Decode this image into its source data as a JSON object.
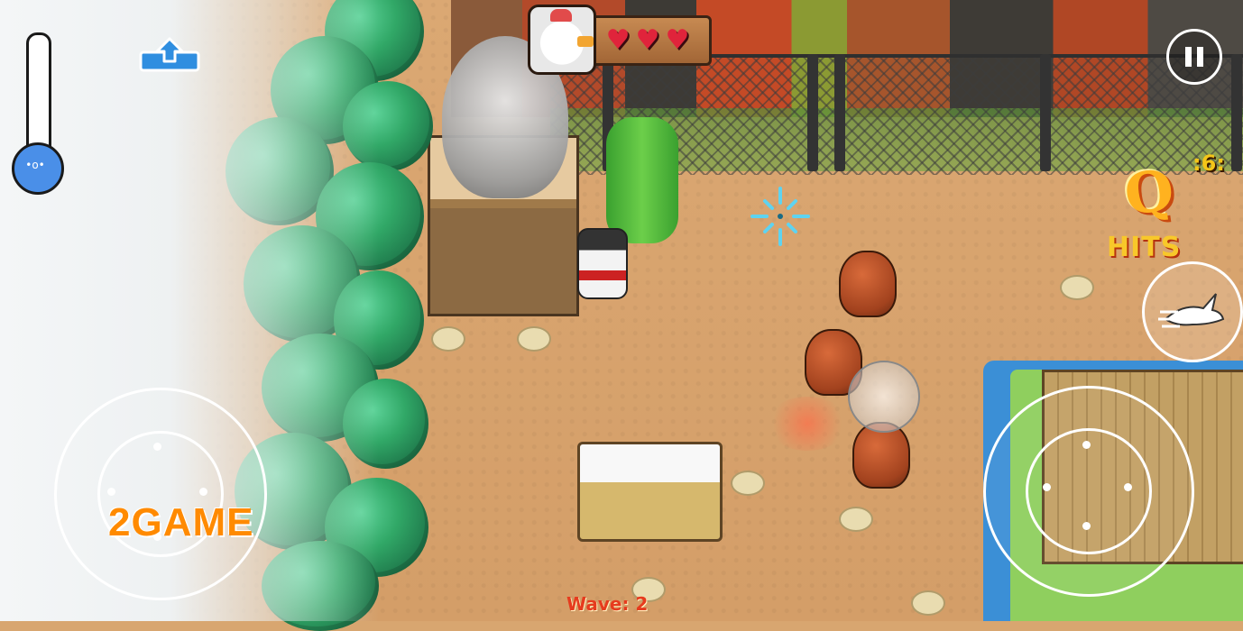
{
  "hud": {
    "health": {
      "hearts": [
        "♥",
        "♥",
        "♥"
      ],
      "heart_count": 3
    },
    "combo": {
      "count_label": ":6:",
      "letter": "Q",
      "hits_label": "HITS"
    },
    "wave_label": "Wave: 2",
    "thermometer": {
      "face": "•o•",
      "level": 0.15
    },
    "icons": {
      "pause": "pause-icon",
      "dash": "rabbit-dash-icon",
      "upload": "upload-icon",
      "crosshair": "crosshair-icon"
    }
  },
  "watermark": "2GAME",
  "colors": {
    "heart": "#e0243b",
    "combo": "#ffb21f",
    "wave_text": "#e63b1e",
    "watermark": "#ff8a00",
    "thermo_fill": "#4a8fe8"
  }
}
